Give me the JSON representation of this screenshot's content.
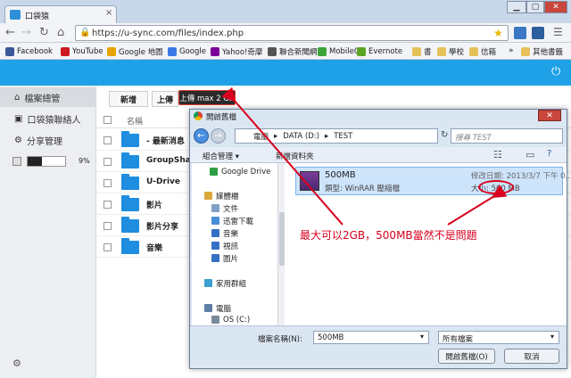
{
  "browser": {
    "tab_title": "口袋猿",
    "url": "https://u-sync.com/files/index.php",
    "window_controls": [
      "▁",
      "▢",
      "✕"
    ]
  },
  "bookmarks": [
    {
      "label": "Facebook",
      "color": "#3b5998"
    },
    {
      "label": "YouTube",
      "color": "#cc181e"
    },
    {
      "label": "Google 地圖",
      "color": "#e8a400"
    },
    {
      "label": "Google",
      "color": "#3c79e6"
    },
    {
      "label": "Yahoo!奇摩",
      "color": "#7b0099"
    },
    {
      "label": "聯合新聞網",
      "color": "#555555"
    },
    {
      "label": "Mobile01",
      "color": "#3aa63a"
    },
    {
      "label": "Evernote",
      "color": "#5ba525"
    },
    {
      "label": "書",
      "color": "#e6c15a"
    },
    {
      "label": "學校",
      "color": "#e6c15a"
    },
    {
      "label": "信箱",
      "color": "#e6c15a"
    },
    {
      "label": "其他書籤",
      "color": "#e6c15a"
    }
  ],
  "sidebar": {
    "items": [
      {
        "label": "檔案總管"
      },
      {
        "label": "口袋猿聯絡人"
      },
      {
        "label": "分享管理"
      }
    ],
    "quota_percent": "9%",
    "quota_fraction": 0.09
  },
  "toolbar": {
    "new_label": "新增",
    "upload_label": "上傳",
    "tooltip": "上傳 max 2 GB"
  },
  "file_list": {
    "header_name": "名稱",
    "folders": [
      "- 最新消息",
      "GroupShare",
      "U-Drive",
      "影片",
      "影片分享",
      "音樂"
    ]
  },
  "dialog": {
    "title": "開啟舊檔",
    "path": [
      "電腦",
      "DATA (D:)",
      "TEST"
    ],
    "search_placeholder": "搜尋 TEST",
    "organize": "組合管理 ▾",
    "new_folder": "新增資料夾",
    "nav": [
      {
        "label": "Google Drive",
        "color": "#2e9e45"
      },
      {
        "label": "媒體櫃",
        "color": "#d9a93b"
      },
      {
        "label": "文件",
        "color": "#7f9fc4"
      },
      {
        "label": "迅雷下載",
        "color": "#4a8fd6"
      },
      {
        "label": "音樂",
        "color": "#3570c4"
      },
      {
        "label": "視訊",
        "color": "#3570c4"
      },
      {
        "label": "圖片",
        "color": "#3570c4"
      },
      {
        "label": "家用群組",
        "color": "#3aa0d0"
      },
      {
        "label": "電腦",
        "color": "#5d7fa8"
      },
      {
        "label": "OS (C:)",
        "color": "#7a8a99"
      }
    ],
    "file": {
      "name": "500MB",
      "type": "類型: WinRAR 壓縮檔",
      "date": "修改日期: 2013/3/7 下午 0...",
      "size_label": "大小:",
      "size": "500 MB"
    },
    "filename_label": "檔案名稱(N):",
    "filename_value": "500MB",
    "filetype": "所有檔案",
    "open_button": "開啟舊檔(O)",
    "cancel_button": "取消"
  },
  "annotation": "最大可以2GB，500MB當然不是問題",
  "colors": {
    "accent": "#1ea1e6",
    "annotation": "#d8001c"
  }
}
